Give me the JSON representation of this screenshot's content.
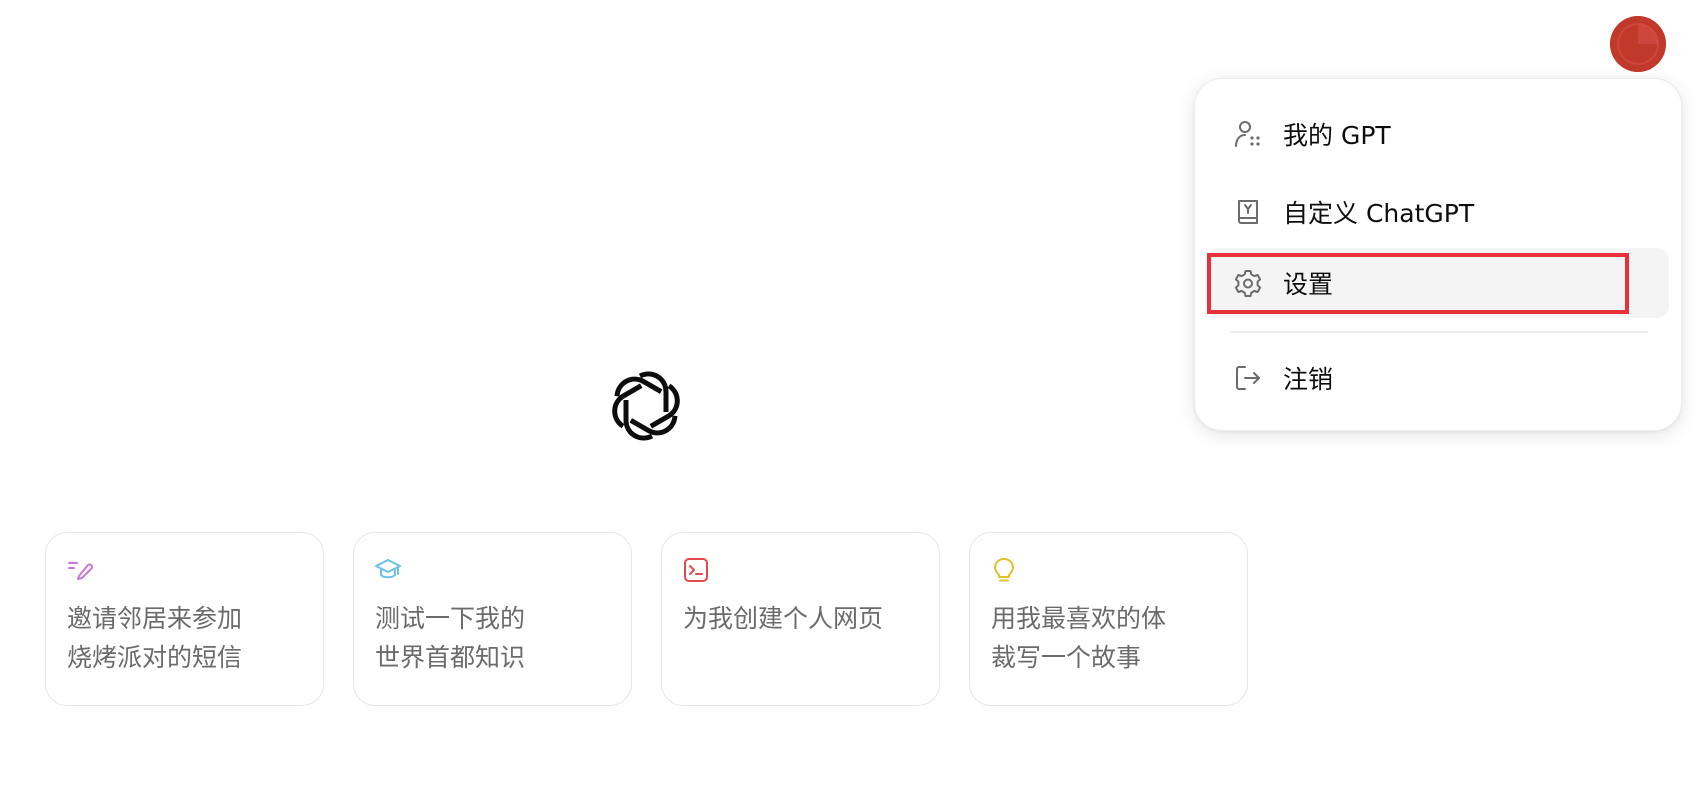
{
  "header": {
    "avatar_icon": "user-avatar",
    "avatar_color": "#c0392b"
  },
  "main": {
    "logo_icon": "openai-logo-icon"
  },
  "suggestions": [
    {
      "icon": "pencil-lines-icon",
      "icon_color": "#c678dd",
      "text": "邀请邻居来参加\n烧烤派对的短信"
    },
    {
      "icon": "graduation-cap-icon",
      "icon_color": "#6ec1e4",
      "text": "测试一下我的\n世界首都知识"
    },
    {
      "icon": "terminal-icon",
      "icon_color": "#e5484d",
      "text": "为我创建个人网页"
    },
    {
      "icon": "lightbulb-icon",
      "icon_color": "#e2c12f",
      "text": "用我最喜欢的体\n裁写一个故事"
    }
  ],
  "menu": {
    "items": [
      {
        "icon": "my-gpts-icon",
        "label": "我的 GPT"
      },
      {
        "icon": "customize-book-icon",
        "label": "自定义 ChatGPT"
      },
      {
        "icon": "gear-icon",
        "label": "设置",
        "highlighted": true
      },
      {
        "icon": "logout-icon",
        "label": "注销"
      }
    ],
    "highlight_color": "#e8313a"
  }
}
